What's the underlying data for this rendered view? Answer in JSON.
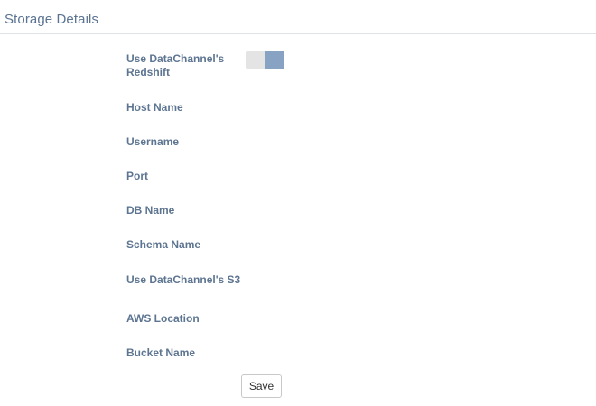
{
  "header": {
    "title": "Storage Details"
  },
  "form": {
    "fields": [
      {
        "label": "Use DataChannel's Redshift"
      },
      {
        "label": "Host Name"
      },
      {
        "label": "Username"
      },
      {
        "label": "Port"
      },
      {
        "label": "DB Name"
      },
      {
        "label": "Schema Name"
      },
      {
        "label": "Use DataChannel's S3"
      },
      {
        "label": "AWS Location"
      },
      {
        "label": "Bucket Name"
      }
    ],
    "redshift_toggle": {
      "state": "on"
    },
    "save_label": "Save"
  },
  "colors": {
    "title": "#5a7391",
    "label": "#5d7591",
    "toggle_track": "#e4e4e4",
    "toggle_knob": "#87a2c2",
    "divider": "#dfe3e8"
  }
}
